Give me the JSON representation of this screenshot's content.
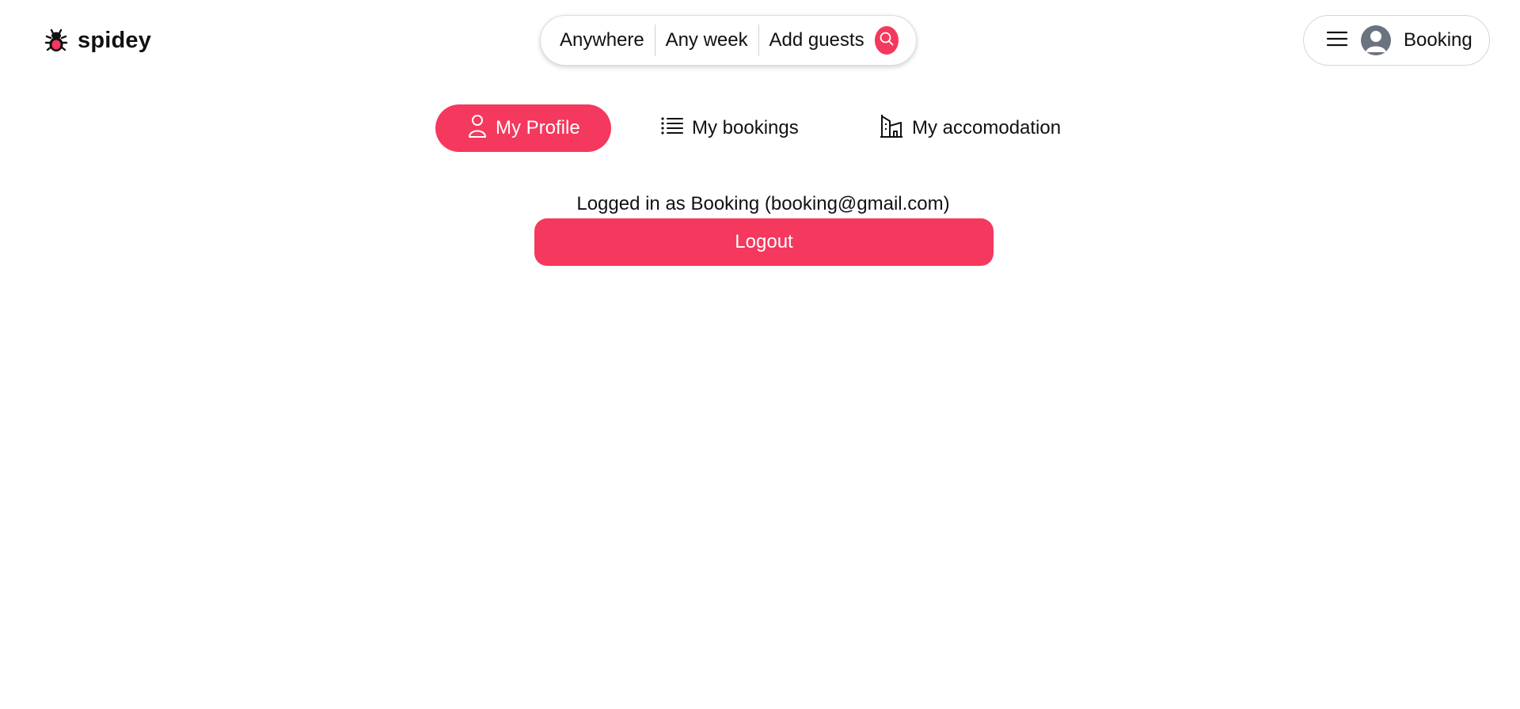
{
  "brand": {
    "name": "spidey",
    "logo_icon": "spider-icon",
    "accent_color": "#f5385d"
  },
  "search": {
    "where": "Anywhere",
    "when": "Any week",
    "guests": "Add guests",
    "button_icon": "search-icon"
  },
  "user_menu": {
    "menu_icon": "hamburger-menu-icon",
    "avatar_icon": "user-avatar-icon",
    "name": "Booking"
  },
  "tabs": [
    {
      "label": "My Profile",
      "icon": "user-icon",
      "active": true
    },
    {
      "label": "My bookings",
      "icon": "list-icon",
      "active": false
    },
    {
      "label": "My accomodation",
      "icon": "building-icon",
      "active": false
    }
  ],
  "profile": {
    "logged_in_text": "Logged in as Booking (booking@gmail.com)",
    "logout_label": "Logout"
  }
}
